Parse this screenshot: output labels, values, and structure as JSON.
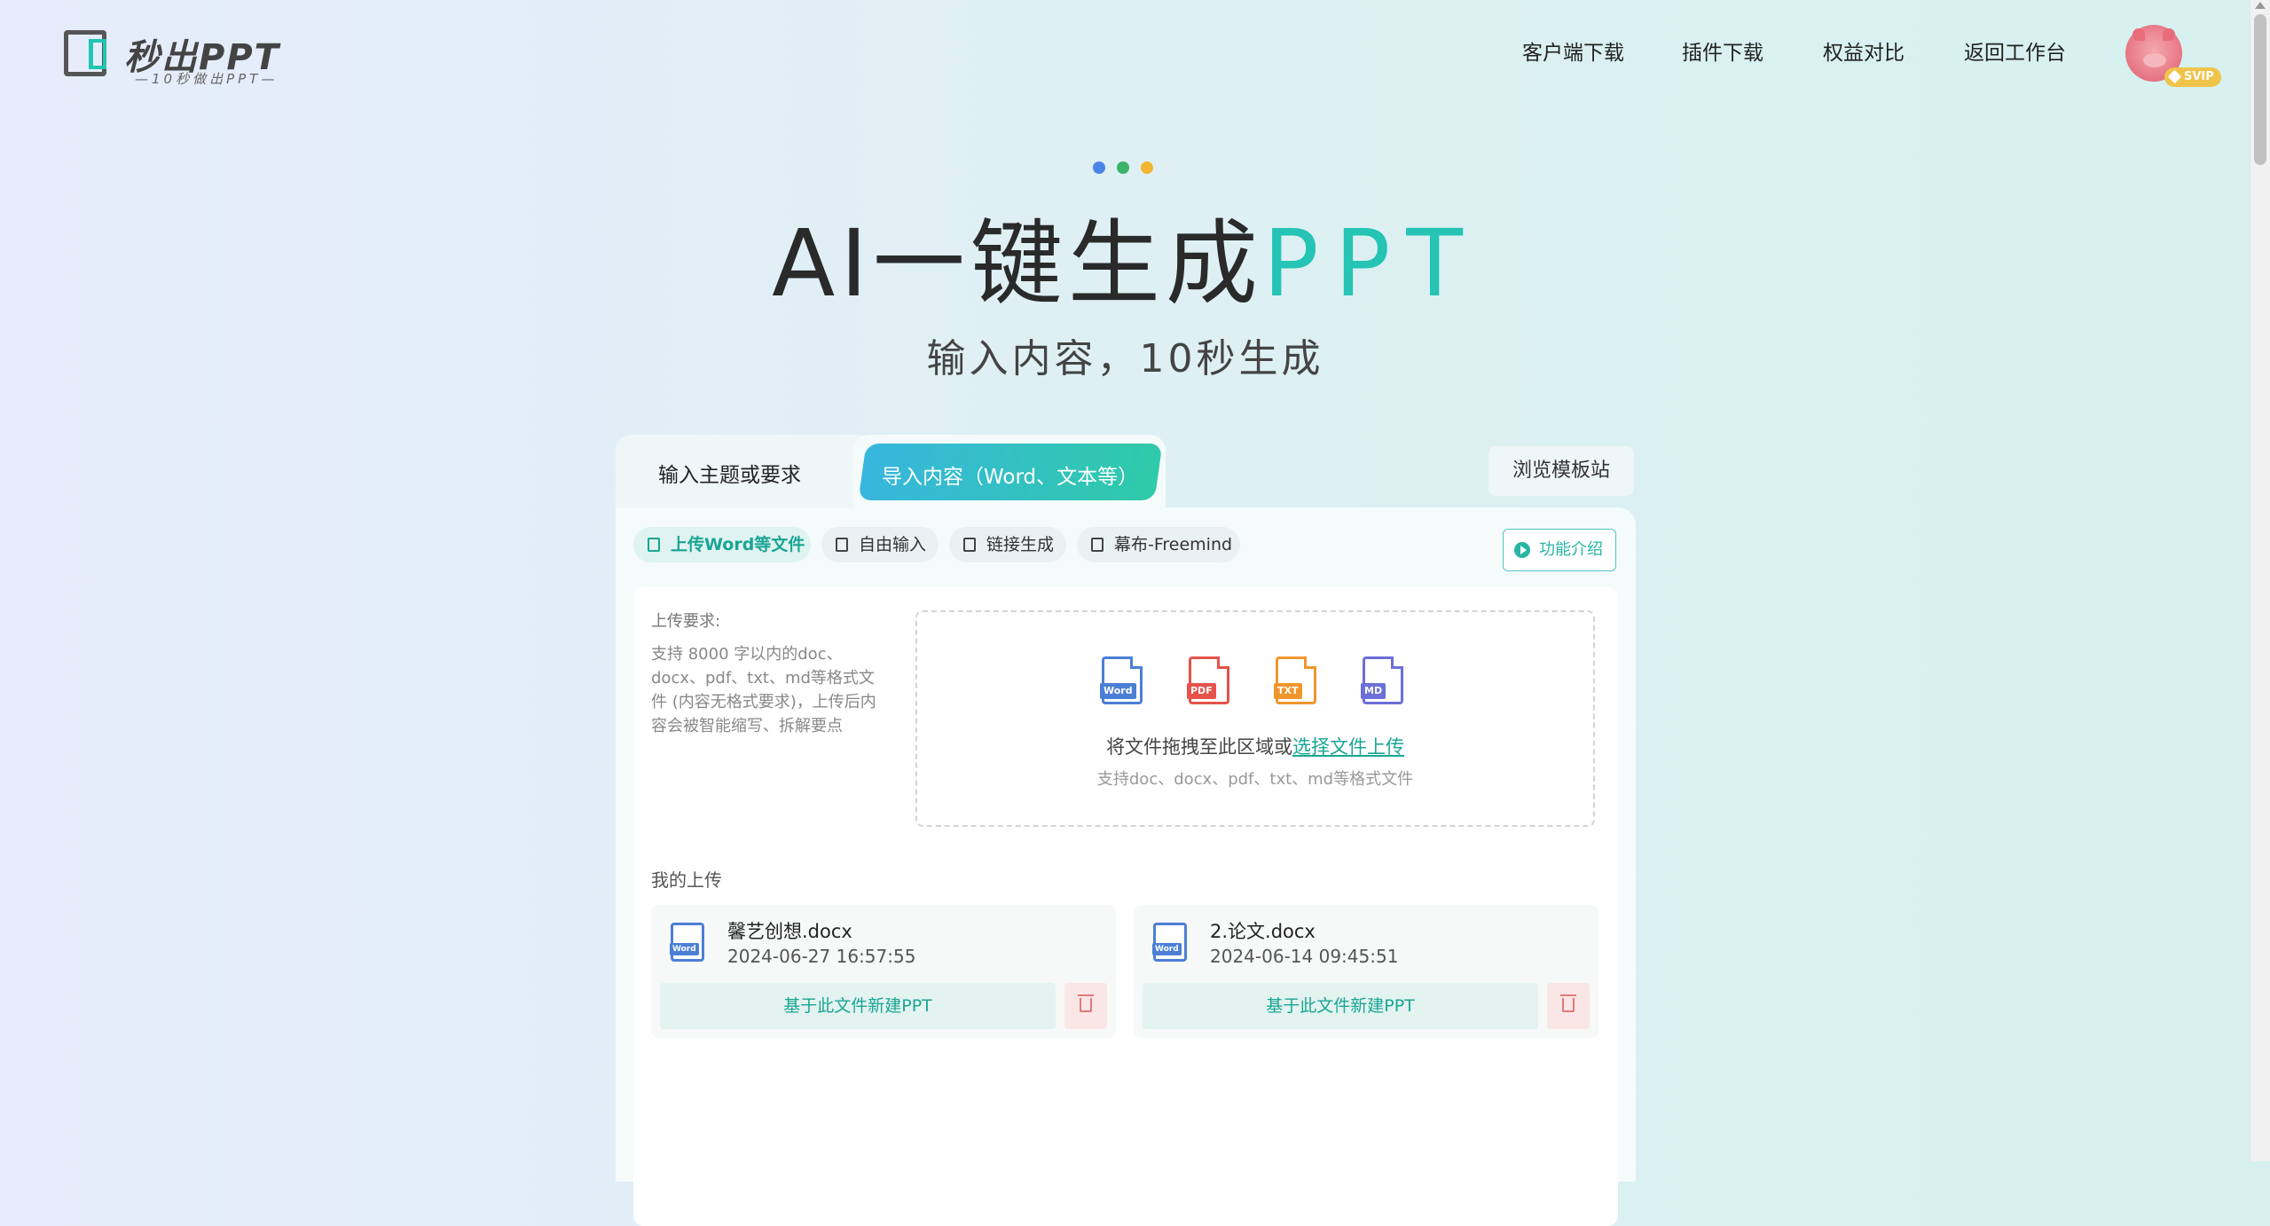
{
  "header": {
    "logo_text": "秒出PPT",
    "logo_sub": "—10秒做出PPT—",
    "nav": [
      "客户端下载",
      "插件下载",
      "权益对比",
      "返回工作台"
    ],
    "badge": "SVIP"
  },
  "hero": {
    "dot_colors": [
      "#4a86e8",
      "#3bb36b",
      "#f2b632"
    ],
    "title_main": "AI一键生成",
    "title_accent": "PPT",
    "subtitle": "输入内容，10秒生成"
  },
  "tabs": {
    "topic": "输入主题或要求",
    "import": "导入内容（Word、文本等）",
    "browse": "浏览模板站"
  },
  "modes": {
    "upload": "上传Word等文件",
    "free": "自由输入",
    "link": "链接生成",
    "freemind": "幕布-Freemind",
    "feature": "功能介绍"
  },
  "upload": {
    "req_title": "上传要求:",
    "req_body": "支持 8000 字以内的doc、docx、pdf、txt、md等格式文件 (内容无格式要求)，上传后内容会被智能缩写、拆解要点",
    "file_types": [
      {
        "icon": "word-file-icon",
        "tag": "Word",
        "color": "#4b7fd6"
      },
      {
        "icon": "pdf-file-icon",
        "tag": "PDF",
        "color": "#e5534b"
      },
      {
        "icon": "txt-file-icon",
        "tag": "TXT",
        "color": "#f0962e"
      },
      {
        "icon": "md-file-icon",
        "tag": "MD",
        "color": "#6c6fd8"
      }
    ],
    "drop_text": "将文件拖拽至此区域或",
    "drop_link": "选择文件上传",
    "drop_hint": "支持doc、docx、pdf、txt、md等格式文件"
  },
  "my_uploads": {
    "title": "我的上传",
    "files": [
      {
        "name": "馨艺创想.docx",
        "date": "2024-06-27 16:57:55",
        "action": "基于此文件新建PPT"
      },
      {
        "name": "2.论文.docx",
        "date": "2024-06-14 09:45:51",
        "action": "基于此文件新建PPT"
      }
    ]
  }
}
